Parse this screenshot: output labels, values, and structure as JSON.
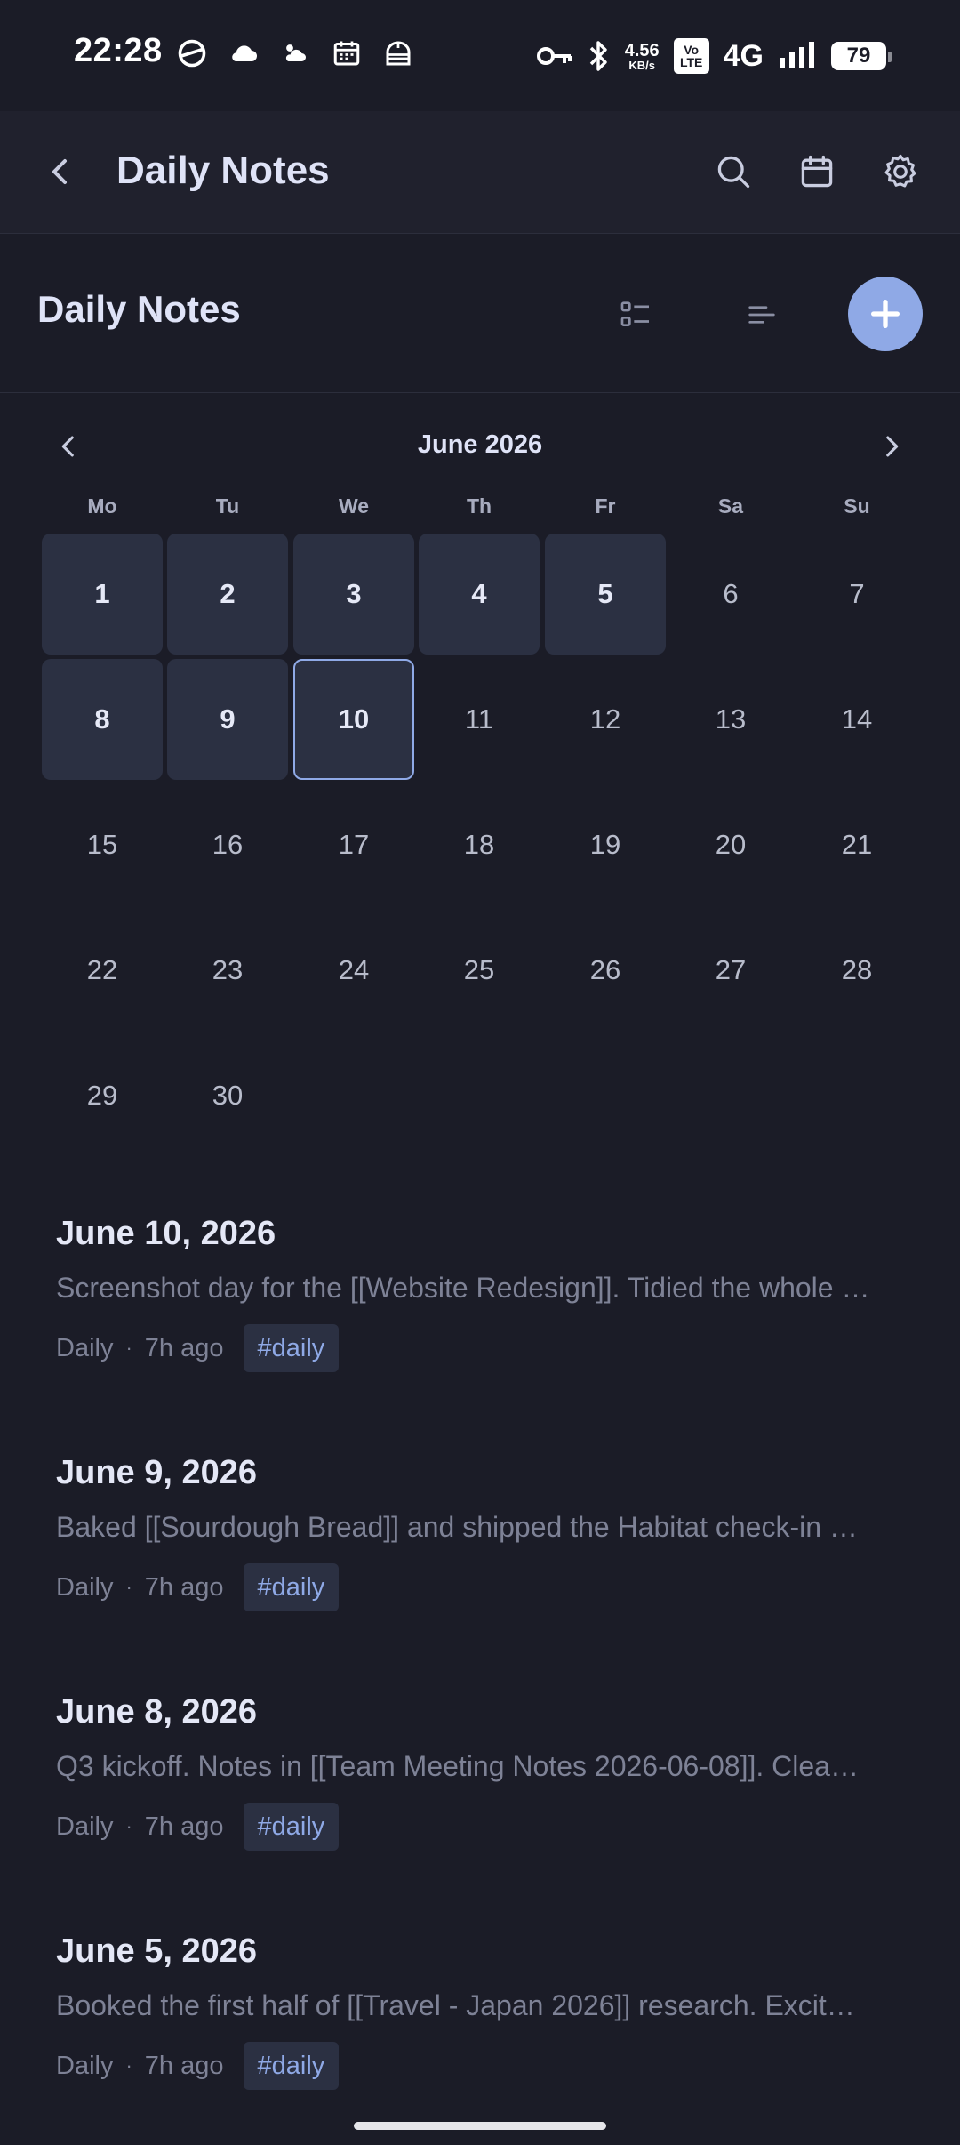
{
  "status_bar": {
    "time": "22:28",
    "speed_value": "4.56",
    "speed_unit": "KB/s",
    "volte_line1": "Vo",
    "volte_line2": "LTE",
    "network": "4G",
    "battery": "79"
  },
  "app_bar": {
    "title": "Daily Notes",
    "icons": [
      "back-icon",
      "search-icon",
      "calendar-icon",
      "settings-icon"
    ]
  },
  "section": {
    "title": "Daily Notes",
    "icons": [
      "list-view-icon",
      "compact-view-icon",
      "add-icon"
    ]
  },
  "calendar": {
    "month_label": "June 2026",
    "weekdays": [
      "Mo",
      "Tu",
      "We",
      "Th",
      "Fr",
      "Sa",
      "Su"
    ],
    "days": [
      {
        "label": "1",
        "has_note": true
      },
      {
        "label": "2",
        "has_note": true
      },
      {
        "label": "3",
        "has_note": true
      },
      {
        "label": "4",
        "has_note": true
      },
      {
        "label": "5",
        "has_note": true
      },
      {
        "label": "6",
        "has_note": false
      },
      {
        "label": "7",
        "has_note": false
      },
      {
        "label": "8",
        "has_note": true
      },
      {
        "label": "9",
        "has_note": true
      },
      {
        "label": "10",
        "has_note": true,
        "today": true
      },
      {
        "label": "11",
        "has_note": false
      },
      {
        "label": "12",
        "has_note": false
      },
      {
        "label": "13",
        "has_note": false
      },
      {
        "label": "14",
        "has_note": false
      },
      {
        "label": "15",
        "has_note": false
      },
      {
        "label": "16",
        "has_note": false
      },
      {
        "label": "17",
        "has_note": false
      },
      {
        "label": "18",
        "has_note": false
      },
      {
        "label": "19",
        "has_note": false
      },
      {
        "label": "20",
        "has_note": false
      },
      {
        "label": "21",
        "has_note": false
      },
      {
        "label": "22",
        "has_note": false
      },
      {
        "label": "23",
        "has_note": false
      },
      {
        "label": "24",
        "has_note": false
      },
      {
        "label": "25",
        "has_note": false
      },
      {
        "label": "26",
        "has_note": false
      },
      {
        "label": "27",
        "has_note": false
      },
      {
        "label": "28",
        "has_note": false
      },
      {
        "label": "29",
        "has_note": false
      },
      {
        "label": "30",
        "has_note": false
      }
    ]
  },
  "notes": [
    {
      "title": "June 10, 2026",
      "preview": "Screenshot day for the [[Website Redesign]]. Tidied the whole …",
      "type": "Daily",
      "sep": "·",
      "time": "7h ago",
      "tag": "#daily"
    },
    {
      "title": "June 9, 2026",
      "preview": "Baked [[Sourdough Bread]] and shipped the Habitat check-in …",
      "type": "Daily",
      "sep": "·",
      "time": "7h ago",
      "tag": "#daily"
    },
    {
      "title": "June 8, 2026",
      "preview": "Q3 kickoff. Notes in [[Team Meeting Notes 2026-06-08]]. Clea…",
      "type": "Daily",
      "sep": "·",
      "time": "7h ago",
      "tag": "#daily"
    },
    {
      "title": "June 5, 2026",
      "preview": "Booked the first half of [[Travel - Japan 2026]] research. Excit…",
      "type": "Daily",
      "sep": "·",
      "time": "7h ago",
      "tag": "#daily"
    }
  ],
  "colors": {
    "background": "#1b1c27",
    "accent": "#8fa9e6",
    "day_cell": "#2b3042"
  }
}
